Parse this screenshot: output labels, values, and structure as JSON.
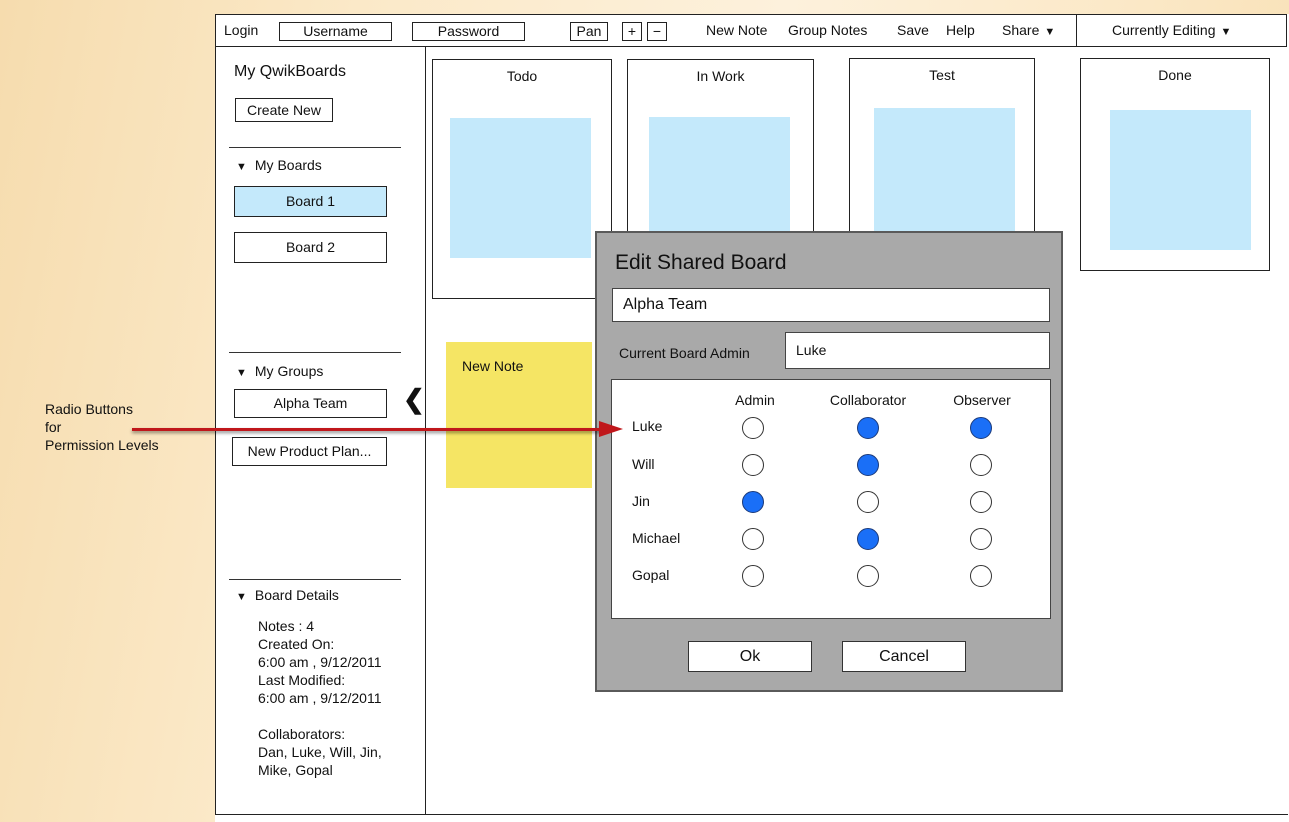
{
  "topbar": {
    "login": "Login",
    "username_placeholder": "Username",
    "password_placeholder": "Password",
    "pan": "Pan",
    "zoom_in": "+",
    "zoom_out": "−",
    "new_note": "New Note",
    "group_notes": "Group Notes",
    "save": "Save",
    "help": "Help",
    "share": "Share",
    "currently_editing": "Currently Editing"
  },
  "sidebar": {
    "title": "My QwikBoards",
    "create_new": "Create New",
    "my_boards_label": "My Boards",
    "boards": [
      "Board 1",
      "Board 2"
    ],
    "selected_board": "Board 1",
    "my_groups_label": "My Groups",
    "groups": [
      "Alpha Team",
      "New Product Plan..."
    ],
    "board_details_label": "Board Details",
    "details": {
      "notes": "Notes : 4",
      "created_label": "Created On:",
      "created_value": "6:00 am , 9/12/2011",
      "modified_label": "Last Modified:",
      "modified_value": "6:00 am , 9/12/2011",
      "collaborators_label": "Collaborators:",
      "collaborators_line1": "Dan, Luke, Will, Jin,",
      "collaborators_line2": "Mike, Gopal"
    }
  },
  "board": {
    "columns": [
      "Todo",
      "In Work",
      "Test",
      "Done"
    ],
    "new_note": "New Note"
  },
  "annotation": {
    "line1": "Radio Buttons",
    "line2": "for",
    "line3": "Permission Levels"
  },
  "dialog": {
    "title": "Edit Shared Board",
    "board_name": "Alpha Team",
    "admin_label": "Current Board Admin",
    "admin_value": "Luke",
    "headers": [
      "Admin",
      "Collaborator",
      "Observer"
    ],
    "members": [
      {
        "name": "Luke",
        "admin": false,
        "collaborator": true,
        "observer": true
      },
      {
        "name": "Will",
        "admin": false,
        "collaborator": true,
        "observer": false
      },
      {
        "name": "Jin",
        "admin": true,
        "collaborator": false,
        "observer": false
      },
      {
        "name": "Michael",
        "admin": false,
        "collaborator": true,
        "observer": false
      },
      {
        "name": "Gopal",
        "admin": false,
        "collaborator": false,
        "observer": false
      }
    ],
    "ok": "Ok",
    "cancel": "Cancel"
  },
  "colors": {
    "radio_selected": "#1a6ff7",
    "note_blue": "#c4e9fb",
    "note_yellow": "#f5e564",
    "arrow_red": "#c0171b",
    "dialog_bg": "#a9a9a9"
  }
}
